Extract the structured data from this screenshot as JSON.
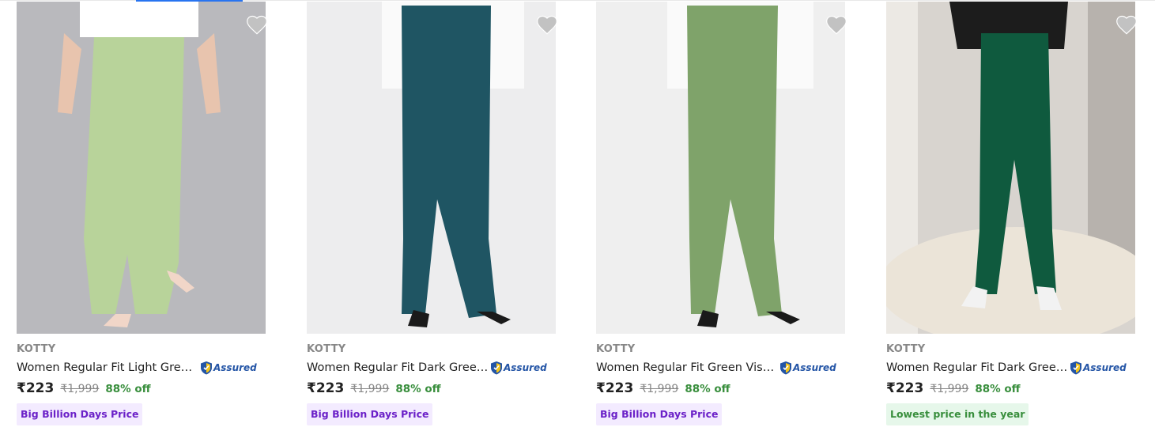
{
  "colors": {
    "accent": "#2874f0",
    "price_off": "#388e3c",
    "badge_purple": "#6b21c8",
    "assured_blue": "#2455a6"
  },
  "products": [
    {
      "brand": "KOTTY",
      "title": "Women Regular Fit Light Green Viscose Rayon Trousers",
      "assured": "Assured",
      "price": "₹223",
      "mrp": "₹1,999",
      "discount": "88% off",
      "badge": "Big Billion Days Price",
      "badge_type": "bbd",
      "wishlist_icon": "heart-icon",
      "pant_color": "#b8d39a"
    },
    {
      "brand": "KOTTY",
      "title": "Women Regular Fit Dark Green Viscose Rayon Trousers",
      "assured": "Assured",
      "price": "₹223",
      "mrp": "₹1,999",
      "discount": "88% off",
      "badge": "Big Billion Days Price",
      "badge_type": "bbd",
      "wishlist_icon": "heart-icon",
      "pant_color": "#1f5563"
    },
    {
      "brand": "KOTTY",
      "title": "Women Regular Fit Green Viscose Rayon Trousers",
      "assured": "Assured",
      "price": "₹223",
      "mrp": "₹1,999",
      "discount": "88% off",
      "badge": "Big Billion Days Price",
      "badge_type": "bbd",
      "wishlist_icon": "heart-icon",
      "pant_color": "#7fa36a"
    },
    {
      "brand": "KOTTY",
      "title": "Women Regular Fit Dark Green Viscose Rayon Trousers",
      "assured": "Assured",
      "price": "₹223",
      "mrp": "₹1,999",
      "discount": "88% off",
      "badge": "Lowest price in the year",
      "badge_type": "low",
      "wishlist_icon": "heart-icon",
      "pant_color": "#0f5a3e"
    }
  ]
}
